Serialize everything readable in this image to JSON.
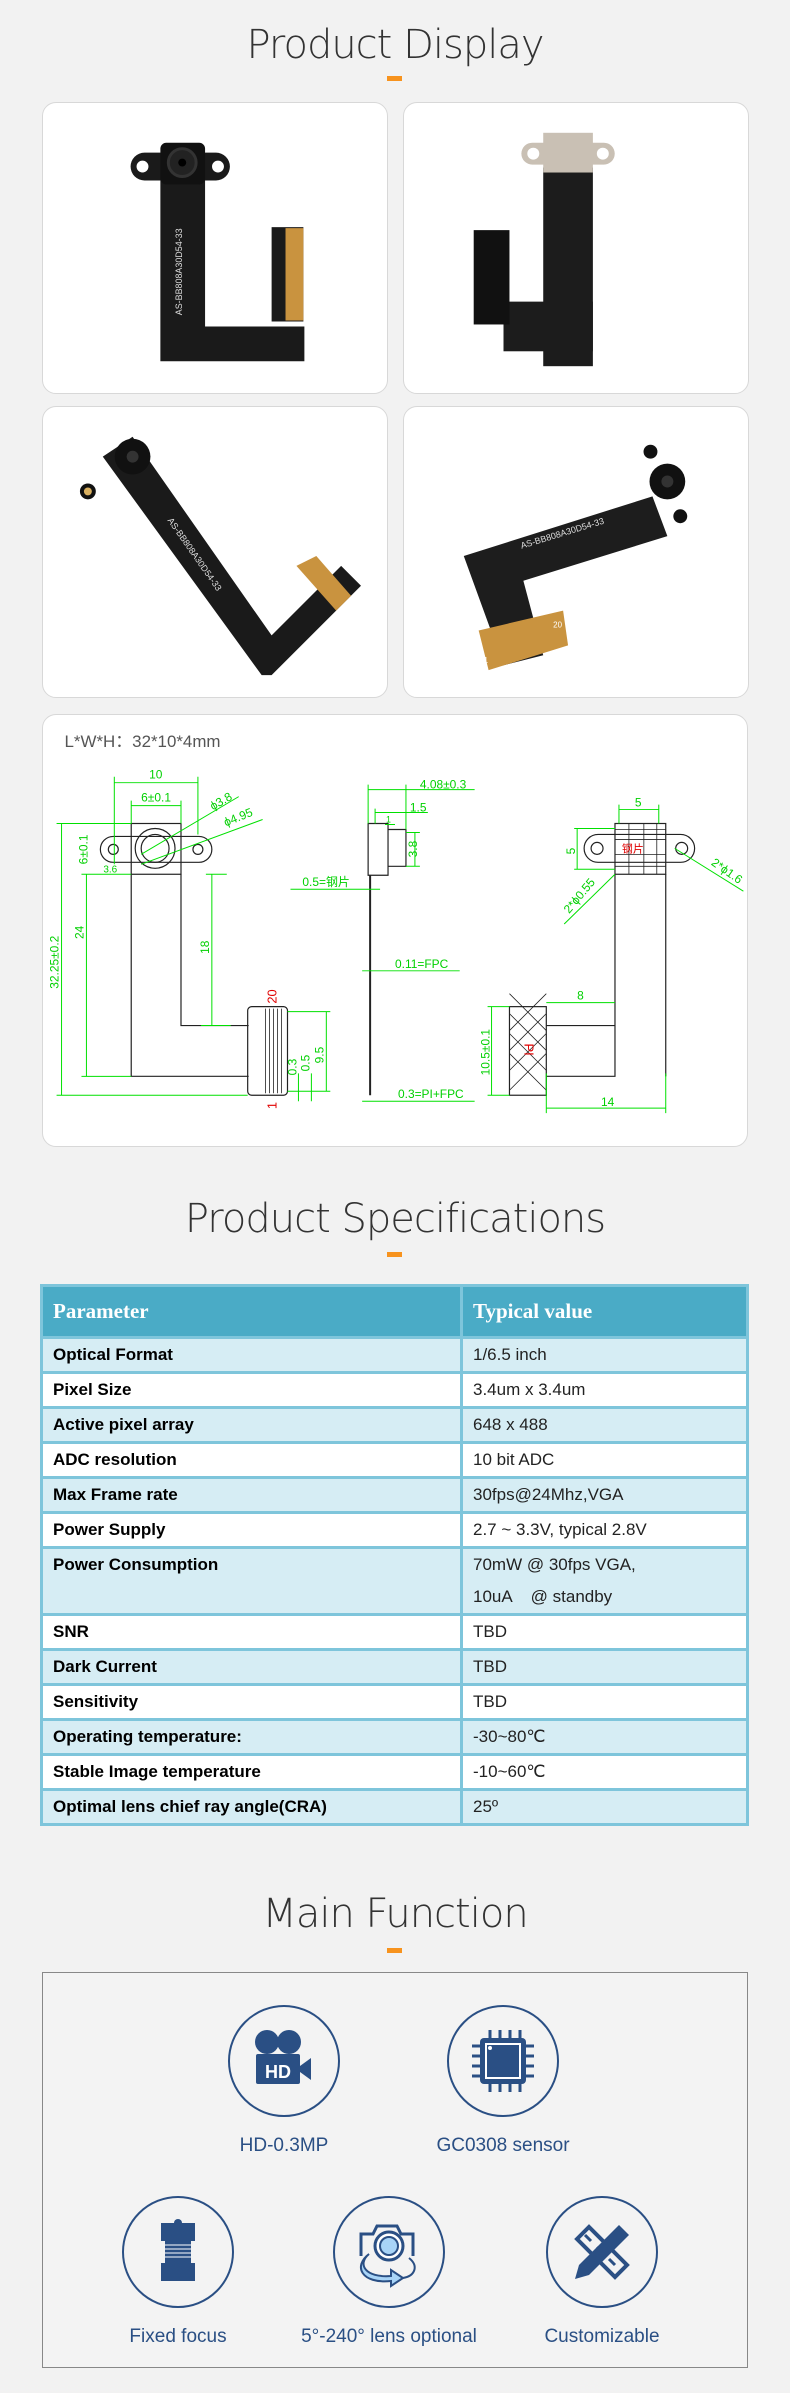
{
  "sections": {
    "display": "Product Display",
    "specs": "Product Specifications",
    "functions": "Main Function"
  },
  "photos": {
    "fpc_print": "AS-BB808A30D54-33",
    "pin_first": "1",
    "pin_last": "20"
  },
  "drawing": {
    "dims_label": "L*W*H：32*10*4mm",
    "front": {
      "w10": "10",
      "w6": "6±0.1",
      "d38": "ϕ3.8",
      "d495": "ϕ4.95",
      "h6": "6±0.1",
      "h36": "3.6",
      "h3225": "32.25±0.2",
      "h24": "24",
      "h18": "18",
      "pin20": "20",
      "pin1": "1",
      "d95": "9.5",
      "d05": "0.5",
      "d03": "0.3"
    },
    "side": {
      "t408": "4.08±0.3",
      "t15": "1.5",
      "t1": "1",
      "t38": "3.8",
      "steel": "0.5=钢片",
      "fpc": "0.11=FPC",
      "pifpc": "0.3=PI+FPC"
    },
    "back": {
      "w5": "5",
      "h5": "5",
      "holes16": "2*ϕ1.6",
      "holes055": "2*ϕ0.55",
      "steel": "钢片",
      "pi": "PI",
      "w8": "8",
      "h105": "10.5±0.1",
      "w14": "14"
    }
  },
  "specs_table": {
    "headers": [
      "Parameter",
      "Typical value"
    ],
    "rows": [
      [
        "Optical Format",
        "1/6.5 inch"
      ],
      [
        "Pixel Size",
        "3.4um x 3.4um"
      ],
      [
        "Active pixel array",
        "648 x 488"
      ],
      [
        "ADC resolution",
        "10 bit ADC"
      ],
      [
        "Max Frame rate",
        "30fps@24Mhz,VGA"
      ],
      [
        "Power Supply",
        "2.7 ~ 3.3V, typical 2.8V"
      ],
      [
        "Power Consumption",
        "70mW @ 30fps VGA,",
        "10uA    @ standby"
      ],
      [
        "SNR",
        "TBD"
      ],
      [
        "Dark Current",
        "TBD"
      ],
      [
        "Sensitivity",
        "TBD"
      ],
      [
        "Operating temperature:",
        "-30~80℃"
      ],
      [
        "Stable Image temperature",
        "-10~60℃"
      ],
      [
        "Optimal lens chief ray angle(CRA)",
        "25º"
      ]
    ]
  },
  "features": [
    {
      "label": "HD-0.3MP",
      "icon": "hd-camera-icon"
    },
    {
      "label": "GC0308 sensor",
      "icon": "chip-icon"
    },
    {
      "label": "Fixed focus",
      "icon": "lens-barrel-icon"
    },
    {
      "label": "5°-240° lens optional",
      "icon": "rotate-camera-icon"
    },
    {
      "label": "Customizable",
      "icon": "pencil-ruler-icon"
    }
  ],
  "colors": {
    "accent": "#f7931e",
    "table_header": "#4aabc6",
    "table_row": "#d6edf4",
    "icon_blue": "#2a4f84",
    "dim_green": "#00e000"
  }
}
